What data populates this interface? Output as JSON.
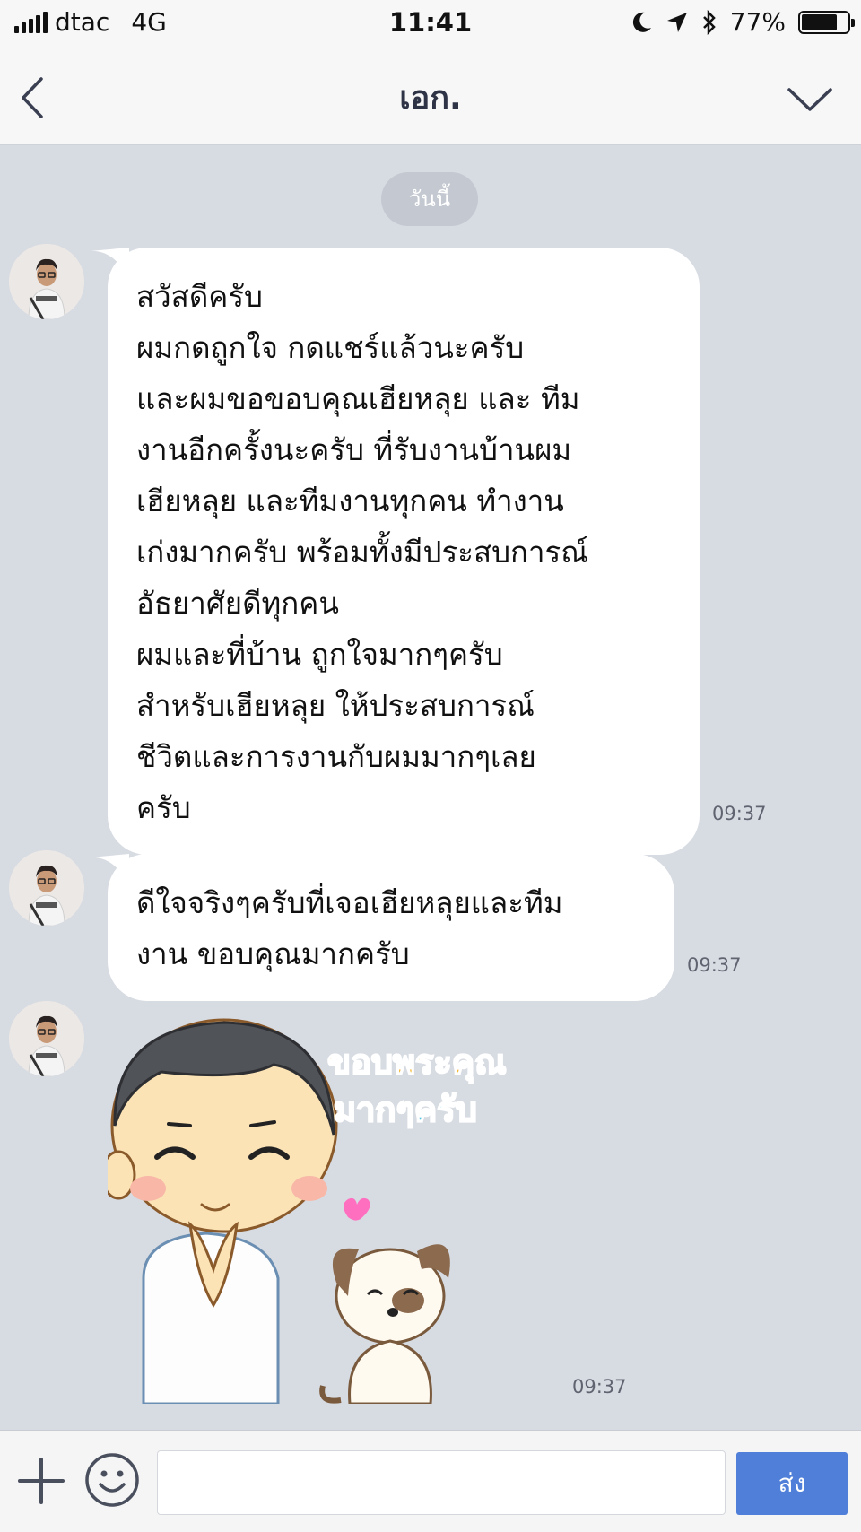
{
  "status_bar": {
    "carrier": "dtac",
    "network": "4G",
    "time": "11:41",
    "battery": "77%",
    "battery_level": 0.77,
    "icons": [
      "signal-bars-icon",
      "moon-icon",
      "location-arrow-icon",
      "bluetooth-icon",
      "battery-icon"
    ]
  },
  "header": {
    "title": "เอก.",
    "back_icon": "chevron-left-icon",
    "menu_icon": "chevron-down-icon"
  },
  "date_label": "วันนี้",
  "messages": [
    {
      "lines": [
        "สวัสดีครับ",
        "ผมกดถูกใจ กดแชร์แล้วนะครับ",
        "และผมขอขอบคุณเฮียหลุย และ ทีม",
        "งานอีกครั้งนะครับ ที่รับงานบ้านผม",
        "เฮียหลุย และทีมงานทุกคน ทำงาน",
        "เก่งมากครับ พร้อมทั้งมีประสบการณ์",
        "อัธยาศัยดีทุกคน",
        "ผมและที่บ้าน ถูกใจมากๆครับ",
        "สำหรับเฮียหลุย ให้ประสบการณ์",
        "ชีวิตและการงานกับผมมากๆเลย",
        "ครับ"
      ],
      "time": "09:37"
    },
    {
      "lines": [
        "ดีใจจริงๆครับที่เจอเฮียหลุยและทีม",
        "งาน ขอบคุณมากครับ"
      ],
      "time": "09:37"
    }
  ],
  "sticker": {
    "text_line1": "ขอบพระคุณ",
    "text_line2": "มากๆครับ",
    "time": "09:37"
  },
  "input_bar": {
    "placeholder": "",
    "send_label": "ส่ง",
    "icons": [
      "plus-icon",
      "emoji-icon"
    ]
  },
  "colors": {
    "chat_background": "#d7dbe2",
    "send_button": "#4f7fd8",
    "sticker_text_1": "#f5b93a",
    "sticker_text_2": "#4fc3e0"
  }
}
